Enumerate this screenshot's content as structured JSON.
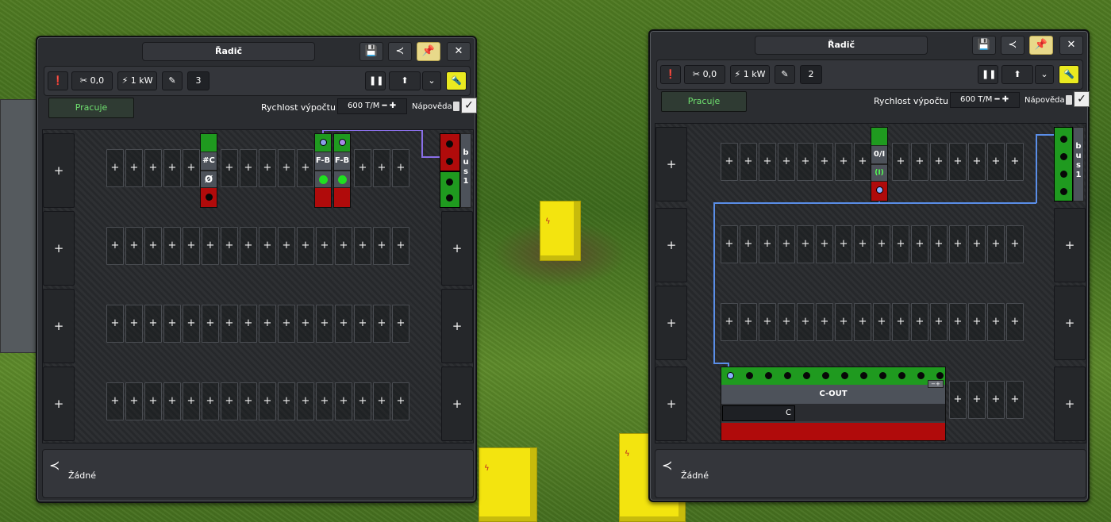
{
  "left_panel": {
    "title": "Řadič",
    "toolbar": {
      "power_readout": "0,0",
      "power_consumption": "1 kW",
      "program_number": "3"
    },
    "status": "Pracuje",
    "speed_label": "Rychlost výpočtu",
    "speed_value": "600 T/M",
    "help_label": "Nápověda",
    "help_checked": true,
    "components": [
      "#C",
      "Ø",
      "F-B",
      "F-B"
    ],
    "bus_label": "bus 1",
    "footer_text": "Žádné"
  },
  "right_panel": {
    "title": "Řadič",
    "toolbar": {
      "power_readout": "0,0",
      "power_consumption": "1 kW",
      "program_number": "2"
    },
    "status": "Pracuje",
    "speed_label": "Rychlost výpočtu",
    "speed_value": "600 T/M",
    "help_label": "Nápověda",
    "help_checked": true,
    "components": [
      "0/I",
      "(I)"
    ],
    "cout": {
      "label": "C-OUT",
      "value": "C"
    },
    "bus_label": "bus 1",
    "footer_text": "Žádné"
  },
  "icons": {
    "save": "save-icon",
    "share": "share-icon",
    "pin": "pin-icon",
    "close": "close-icon",
    "alert": "alert-icon",
    "tools": "tools-icon",
    "power": "lightning-icon",
    "edit": "edit-icon",
    "pause": "pause-icon",
    "upload": "upload-icon",
    "chevron": "chevron-down-icon",
    "torch": "torch-icon",
    "add": "plus-icon"
  },
  "colors": {
    "status_green": "#6fe06f",
    "port_green": "#1f9a1f",
    "port_red": "#b00b0b",
    "pin_yellow": "#e8d98a",
    "wire_purple": "#8a6fe8",
    "wire_blue": "#5a8ee8"
  }
}
